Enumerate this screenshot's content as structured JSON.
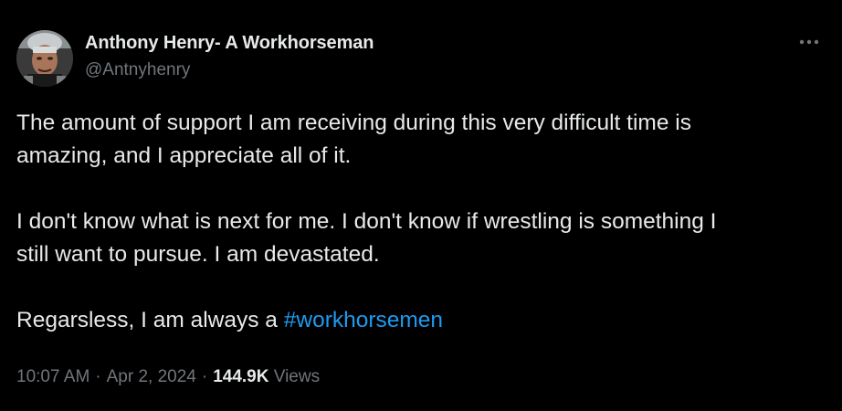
{
  "author": {
    "name": "Anthony Henry- A Workhorseman",
    "handle": "@Antnyhenry"
  },
  "tweet": {
    "paragraphs": [
      {
        "line1": "The amount of support I am receiving during this very difficult time is",
        "line2": "amazing, and I appreciate all of it."
      },
      {
        "line1": "I don't know what is next for me. I don't know if wrestling is something I",
        "line2": "still want to pursue. I am devastated."
      }
    ],
    "closing_text": "Regarsless, I am always a ",
    "hashtag": "#workhorsemen"
  },
  "meta": {
    "time": "10:07 AM",
    "separator": "·",
    "date": "Apr 2, 2024",
    "views_count": "144.9K",
    "views_label": "Views"
  },
  "icons": {
    "more": "more-horizontal-icon"
  },
  "colors": {
    "background": "#000000",
    "text_primary": "#e7e9ea",
    "text_secondary": "#71767b",
    "link": "#1d9bf0"
  }
}
